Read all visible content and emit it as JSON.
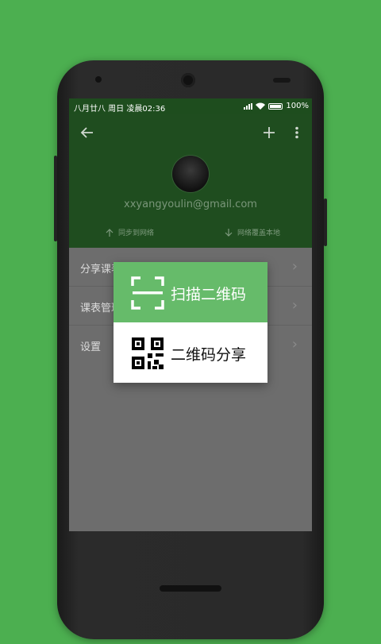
{
  "statusbar": {
    "left_text": "八月廿八  周日  凌晨02:36",
    "battery": "100%"
  },
  "header": {
    "email": "xxyangyoulin@gmail.com",
    "sync_up": "同步到网络",
    "sync_down": "网络覆盖本地"
  },
  "list": {
    "items": [
      {
        "label": "分享课表"
      },
      {
        "label": "课表管理"
      },
      {
        "label": "设置"
      }
    ]
  },
  "popup": {
    "scan_label": "扫描二维码",
    "share_label": "二维码分享"
  },
  "colors": {
    "background": "#4caf50",
    "header": "#1f4d1f",
    "scan_bg": "#66bb6a"
  }
}
